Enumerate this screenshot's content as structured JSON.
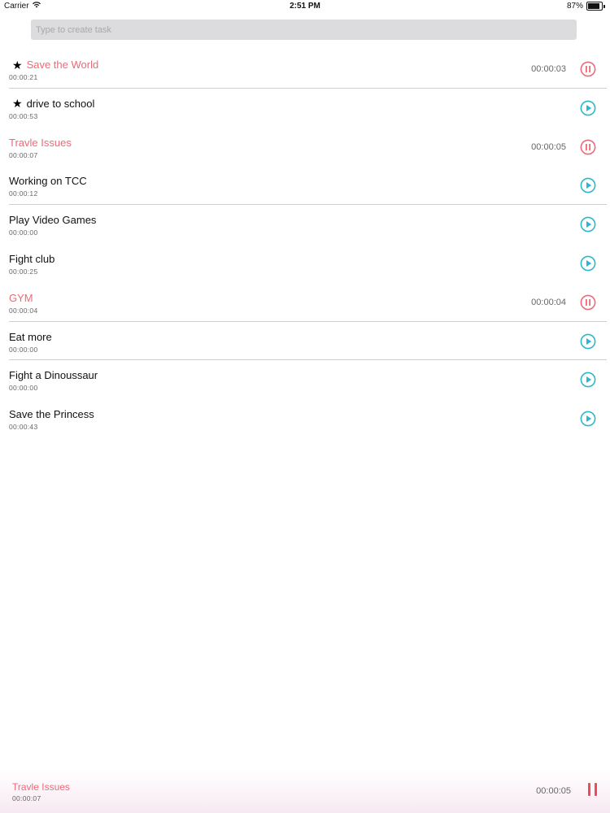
{
  "status_bar": {
    "carrier": "Carrier",
    "time": "2:51 PM",
    "battery": "87%",
    "battery_level": 0.87,
    "wifi_icon": "wifi-icon",
    "battery_icon": "battery-icon"
  },
  "create": {
    "placeholder": "Type to create task",
    "value": ""
  },
  "colors": {
    "running": "#ec6a78",
    "play": "#2cb8c8",
    "pause": "#ec6a78"
  },
  "tasks": [
    {
      "title": "Save the World",
      "total": "00:00:21",
      "elapsed": "00:00:03",
      "starred": true,
      "running": true
    },
    {
      "title": "drive to school",
      "total": "00:00:53",
      "elapsed": "",
      "starred": true,
      "running": false
    },
    {
      "title": "Travle Issues",
      "total": "00:00:07",
      "elapsed": "00:00:05",
      "starred": false,
      "running": true
    },
    {
      "title": "Working on TCC",
      "total": "00:00:12",
      "elapsed": "",
      "starred": false,
      "running": false
    },
    {
      "title": "Play Video Games",
      "total": "00:00:00",
      "elapsed": "",
      "starred": false,
      "running": false
    },
    {
      "title": "Fight club",
      "total": "00:00:25",
      "elapsed": "",
      "starred": false,
      "running": false
    },
    {
      "title": "GYM",
      "total": "00:00:04",
      "elapsed": "00:00:04",
      "starred": false,
      "running": true
    },
    {
      "title": "Eat more",
      "total": "00:00:00",
      "elapsed": "",
      "starred": false,
      "running": false
    },
    {
      "title": "Fight a Dinoussaur",
      "total": "00:00:00",
      "elapsed": "",
      "starred": false,
      "running": false
    },
    {
      "title": "Save the Princess",
      "total": "00:00:43",
      "elapsed": "",
      "starred": false,
      "running": false
    }
  ],
  "dividers_after": [
    0,
    3,
    6,
    7
  ],
  "current_task": {
    "title": "Travle Issues",
    "total": "00:00:07",
    "elapsed": "00:00:05",
    "pause_icon": "pause-icon"
  }
}
